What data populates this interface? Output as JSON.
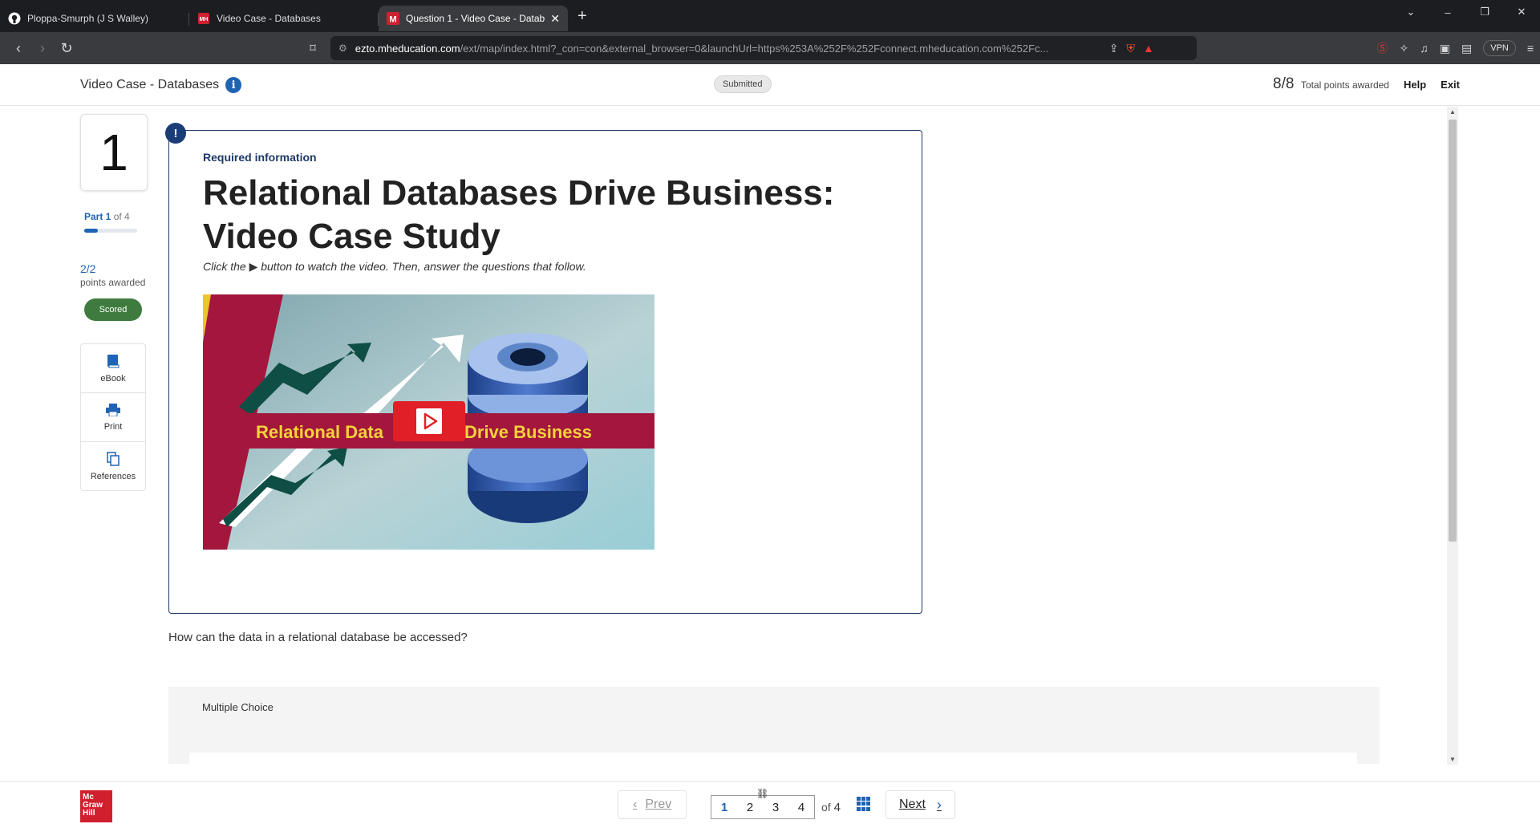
{
  "browser": {
    "tabs": [
      {
        "label": "Ploppa-Smurph (J S Walley)",
        "icon": "github-icon"
      },
      {
        "label": "Video Case - Databases",
        "icon": "mh-icon"
      },
      {
        "label": "Question 1 - Video Case - Datab",
        "icon": "m-icon",
        "active": true
      }
    ],
    "url_host": "ezto.mheducation.com",
    "url_path": "/ext/map/index.html?_con=con&external_browser=0&launchUrl=https%253A%252F%252Fconnect.mheducation.com%252Fc...",
    "vpn_label": "VPN"
  },
  "header": {
    "title": "Video Case - Databases",
    "status": "Submitted",
    "score": "8/8",
    "score_label": "Total points awarded",
    "help": "Help",
    "exit": "Exit"
  },
  "sidebar": {
    "question_number": "1",
    "part_prefix": "Part 1",
    "part_suffix": " of 4",
    "part_progress": 0.25,
    "points": "2/2",
    "points_label": "points awarded",
    "scored": "Scored",
    "tools": [
      {
        "label": "eBook",
        "icon": "ebook-icon"
      },
      {
        "label": "Print",
        "icon": "print-icon"
      },
      {
        "label": "References",
        "icon": "references-icon"
      }
    ]
  },
  "content": {
    "required": "Required information",
    "headline": "Relational Databases Drive Business: Video Case Study",
    "instruction": "Click the ▶ button to watch the video. Then, answer the questions that follow.",
    "video_banner_left": "Relational Data",
    "video_banner_right": "Drive Business",
    "question": "How can the data in a relational database be accessed?",
    "question_type": "Multiple Choice"
  },
  "footer": {
    "prev": "Prev",
    "next": "Next",
    "pages": [
      "1",
      "2",
      "3",
      "4"
    ],
    "current_page": "1",
    "of_label": "of",
    "total_pages": "4",
    "logo_lines": [
      "Mc",
      "Graw",
      "Hill"
    ]
  },
  "colors": {
    "accent_blue": "#1f63b3",
    "scored_green": "#3f7b3f",
    "brand_red": "#d0202e"
  }
}
